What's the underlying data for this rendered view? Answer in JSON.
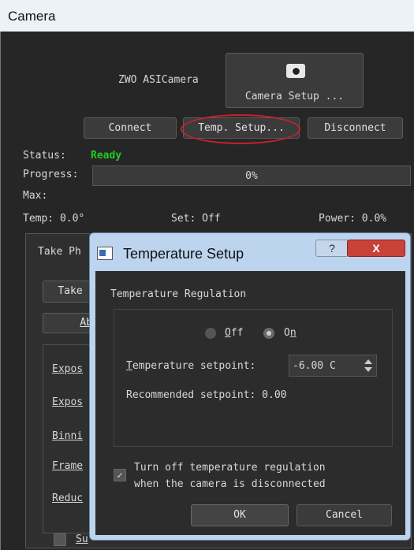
{
  "window": {
    "title": "Camera"
  },
  "camera": {
    "name": "ZWO ASICamera",
    "setup_label": "Camera Setup ..."
  },
  "buttons": {
    "connect": "Connect",
    "temp_setup": "Temp. Setup...",
    "disconnect": "Disconnect"
  },
  "status": {
    "label": "Status:",
    "value": "Ready",
    "progress_label": "Progress:",
    "progress_value": 0,
    "progress_text": "0%",
    "max_label": "Max:"
  },
  "temps": {
    "temp": "Temp: 0.0°",
    "set": "Set: Off",
    "power": "Power: 0.0%"
  },
  "bg_panel": {
    "tab_label": "Take Ph",
    "take_btn": "Take",
    "abort_btn": "Ab",
    "rows": [
      "Expos",
      "Expos",
      "Binni",
      "Frame",
      "Reduc"
    ],
    "bottom_item": "Su"
  },
  "dialog": {
    "title": "Temperature Setup",
    "help": "?",
    "close": "X",
    "group_label": "Temperature Regulation",
    "radio_off": "Off",
    "radio_on": "On",
    "setpoint_label": "Temperature setpoint:",
    "setpoint_value": "-6.00 C",
    "recommended_label": "Recommended setpoint: 0.00",
    "checkbox_line1": "Turn off temperature regulation",
    "checkbox_line2": "when the camera is disconnected",
    "checkbox_checked": true,
    "ok": "OK",
    "cancel": "Cancel"
  }
}
